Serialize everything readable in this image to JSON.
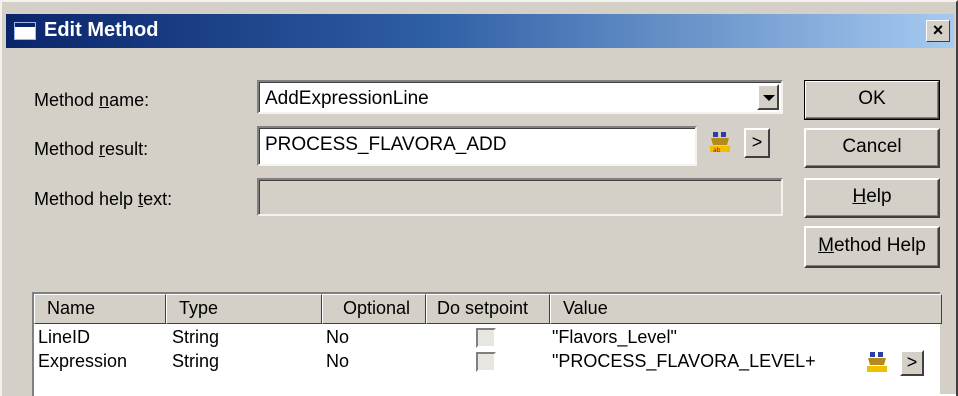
{
  "dialog": {
    "title": "Edit Method",
    "close_glyph": "×"
  },
  "fields": {
    "method_name": {
      "label_pre": "Method ",
      "label_key": "n",
      "label_post": "ame:",
      "value": "AddExpressionLine"
    },
    "method_result": {
      "label_pre": "Method ",
      "label_key": "r",
      "label_post": "esult:",
      "value": "PROCESS_FLAVORA_ADD"
    },
    "method_help_text": {
      "label_pre": "Method help ",
      "label_key": "t",
      "label_post": "ext:",
      "value": ""
    }
  },
  "buttons": {
    "ok": "OK",
    "cancel": "Cancel",
    "help_key": "H",
    "help_rest": "elp",
    "method_help_key": "M",
    "method_help_rest": "ethod Help",
    "arrow": ">"
  },
  "table": {
    "columns": [
      "Name",
      "Type",
      "Optional",
      "Do setpoint",
      "Value"
    ],
    "rows": [
      {
        "name": "LineID",
        "type": "String",
        "optional": "No",
        "value": "\"Flavors_Level\""
      },
      {
        "name": "Expression",
        "type": "String",
        "optional": "No",
        "value": "\"PROCESS_FLAVORA_LEVEL+"
      }
    ]
  },
  "icons": {
    "expression_builder": "expression-builder-icon",
    "dropdown": "chevron-down-icon"
  }
}
